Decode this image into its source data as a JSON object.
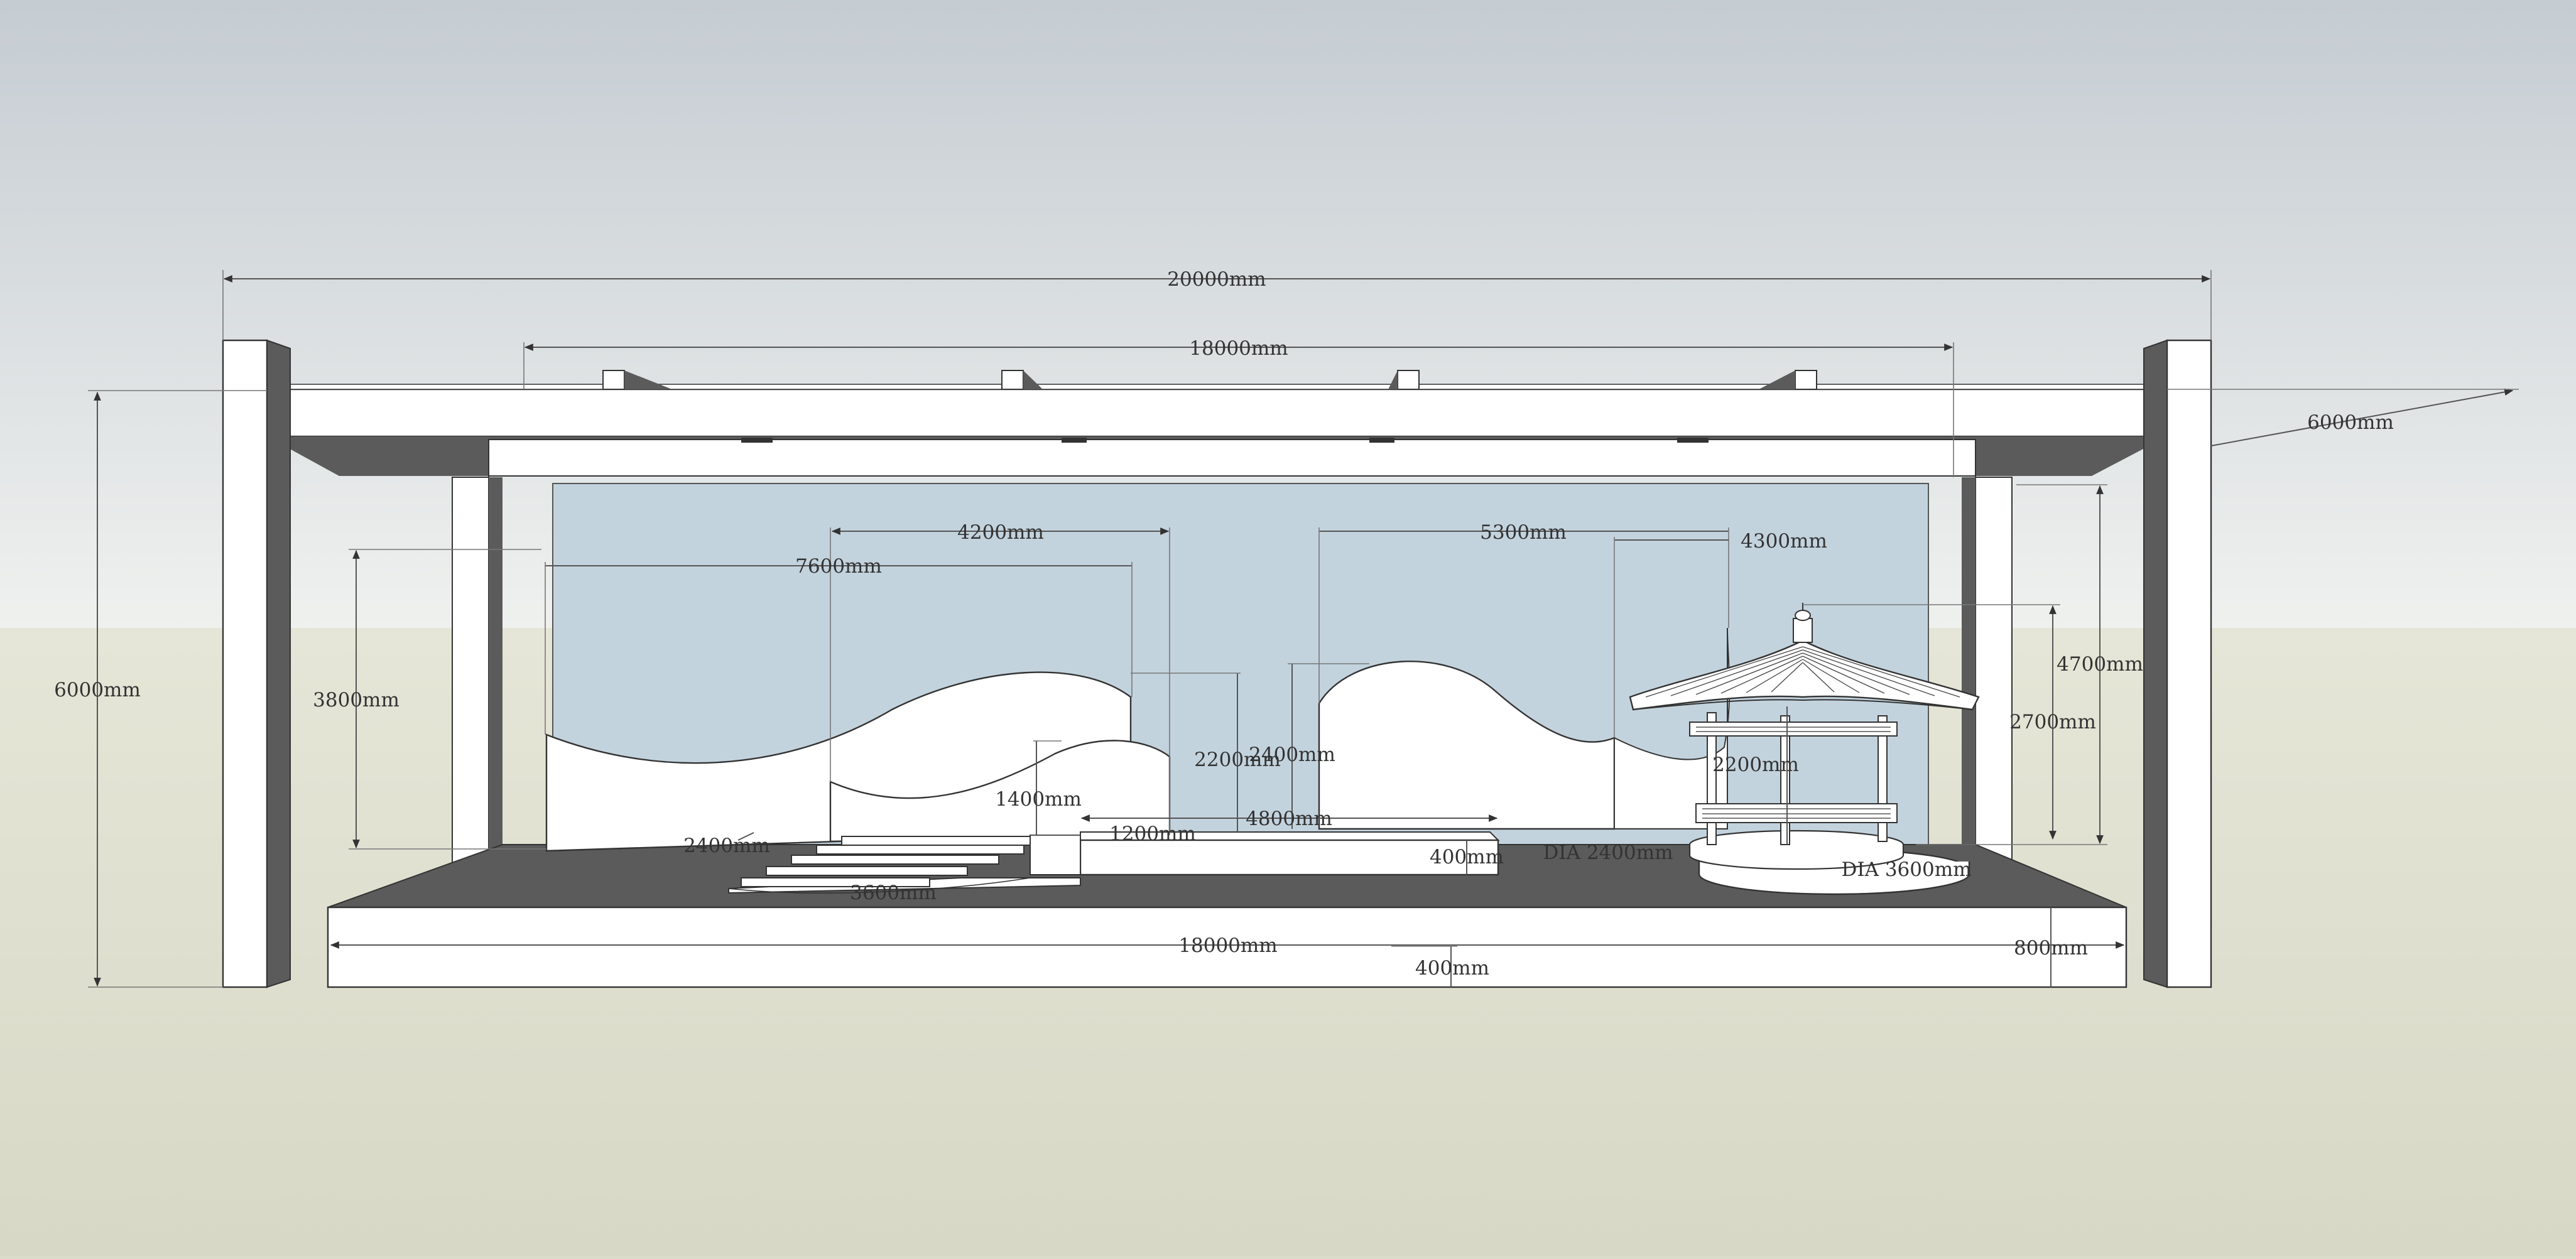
{
  "dimensions": {
    "total_width": "20000mm",
    "inner_width": "18000mm",
    "depth": "6000mm",
    "height": "6000mm",
    "left_wave_width": "7600mm",
    "front_wave_width": "4200mm",
    "right_wave_width": "5300mm",
    "right_inner_width": "4300mm",
    "left_wave_height": "3800mm",
    "mid_wave_height": "2200mm",
    "right_wave_height": "2400mm",
    "front_wave_height": "1400mm",
    "pavilion_total_height": "4700mm",
    "pavilion_roof_height": "2700mm",
    "pavilion_column_height": "2200mm",
    "stage_step_width": "1200mm",
    "platform_width": "4800mm",
    "platform_height": "400mm",
    "stair_width": "2400mm",
    "stair_depth": "3600mm",
    "pavilion_base_dia": "DIA 2400mm",
    "pavilion_outer_dia": "DIA 3600mm",
    "floor_width": "18000mm",
    "floor_height": "800mm",
    "floor_step": "400mm"
  },
  "colors": {
    "sky_top": "#c5ccd2",
    "sky_bottom": "#eef0ee",
    "ground": "#dcdccb",
    "backdrop": "#c3d3de",
    "dark_surface": "#5b5b5b",
    "structure_white": "#ffffff",
    "line": "#333333"
  }
}
